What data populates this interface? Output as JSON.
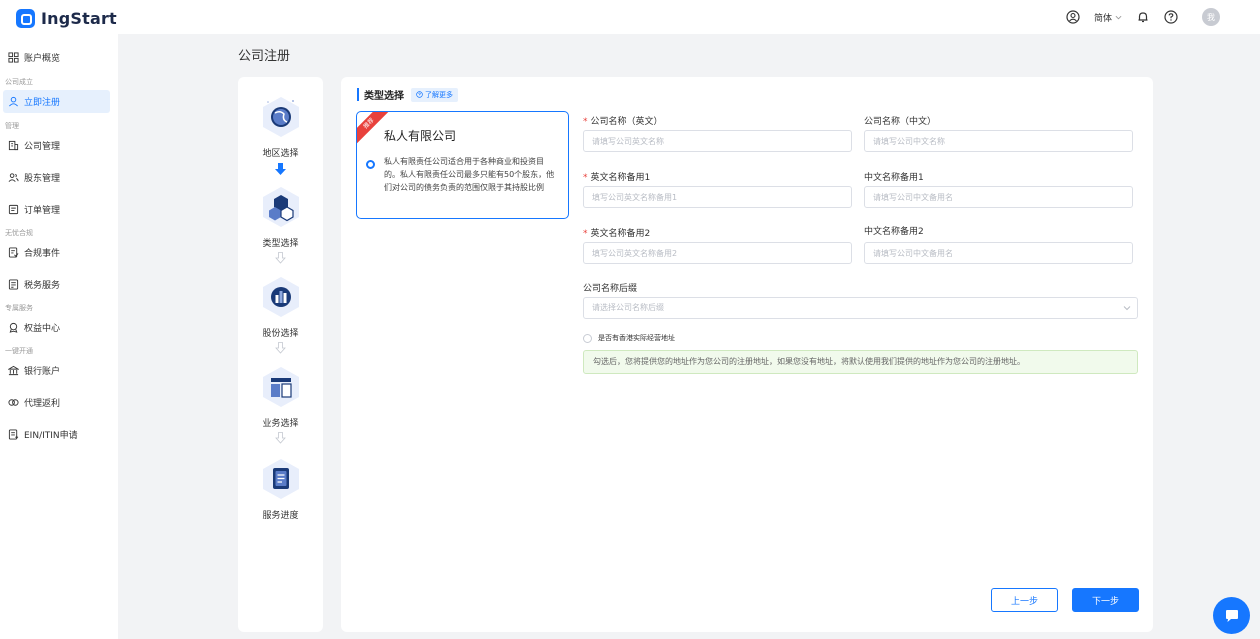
{
  "app": {
    "logo_text": "IngStart"
  },
  "header": {
    "language": "简体",
    "avatar_text": "我"
  },
  "sidebar": {
    "items": [
      {
        "type": "item",
        "label": "账户概览",
        "icon": "grid-icon"
      },
      {
        "type": "group",
        "label": "公司成立"
      },
      {
        "type": "item",
        "label": "立即注册",
        "icon": "user-icon",
        "active": true
      },
      {
        "type": "group",
        "label": "管理"
      },
      {
        "type": "item",
        "label": "公司管理",
        "icon": "building-icon"
      },
      {
        "type": "item",
        "label": "股东管理",
        "icon": "users-icon"
      },
      {
        "type": "item",
        "label": "订单管理",
        "icon": "order-icon"
      },
      {
        "type": "group",
        "label": "无忧合规"
      },
      {
        "type": "item",
        "label": "合规事件",
        "icon": "doc-check-icon"
      },
      {
        "type": "item",
        "label": "税务服务",
        "icon": "tax-icon"
      },
      {
        "type": "group",
        "label": "专属服务"
      },
      {
        "type": "item",
        "label": "权益中心",
        "icon": "badge-icon"
      },
      {
        "type": "group",
        "label": "一键开通"
      },
      {
        "type": "item",
        "label": "银行账户",
        "icon": "bank-icon"
      },
      {
        "type": "item",
        "label": "代理返利",
        "icon": "rebate-icon"
      },
      {
        "type": "item",
        "label": "EIN/ITIN申请",
        "icon": "form-icon"
      }
    ]
  },
  "page": {
    "title": "公司注册"
  },
  "steps": [
    {
      "label": "地区选择",
      "icon": "globe-icon"
    },
    {
      "label": "类型选择",
      "icon": "cubes-icon"
    },
    {
      "label": "股份选择",
      "icon": "bar-chart-icon"
    },
    {
      "label": "业务选择",
      "icon": "layout-icon"
    },
    {
      "label": "服务进度",
      "icon": "document-icon"
    }
  ],
  "section": {
    "title": "类型选择",
    "learn_more": "了解更多"
  },
  "type_card": {
    "ribbon": "推荐",
    "name": "私人有限公司",
    "description": "私人有限责任公司适合用于各种商业和投资目的。私人有限责任公司最多只能有50个股东，他们对公司的债务负责的范围仅限于其持股比例"
  },
  "form": {
    "name_en": {
      "label": "公司名称（英文）",
      "required": "*",
      "placeholder": "请填写公司英文名称"
    },
    "name_cn": {
      "label": "公司名称（中文）",
      "placeholder": "请填写公司中文名称"
    },
    "alt_en_1": {
      "label": "英文名称备用1",
      "required": "*",
      "placeholder": "填写公司英文名称备用1"
    },
    "alt_cn_1": {
      "label": "中文名称备用1",
      "placeholder": "请填写公司中文备用名"
    },
    "alt_en_2": {
      "label": "英文名称备用2",
      "required": "*",
      "placeholder": "填写公司英文名称备用2"
    },
    "alt_cn_2": {
      "label": "中文名称备用2",
      "placeholder": "请填写公司中文备用名"
    },
    "suffix": {
      "label": "公司名称后缀",
      "placeholder": "请选择公司名称后缀"
    },
    "hk_address": {
      "label": "是否有香港实际经营地址"
    },
    "notice": "勾选后，您将提供您的地址作为您公司的注册地址，如果您没有地址，将默认使用我们提供的地址作为您公司的注册地址。"
  },
  "buttons": {
    "prev": "上一步",
    "next": "下一步"
  },
  "colors": {
    "primary": "#1677ff",
    "danger": "#e8413c",
    "notice_bg": "#f1faec"
  }
}
